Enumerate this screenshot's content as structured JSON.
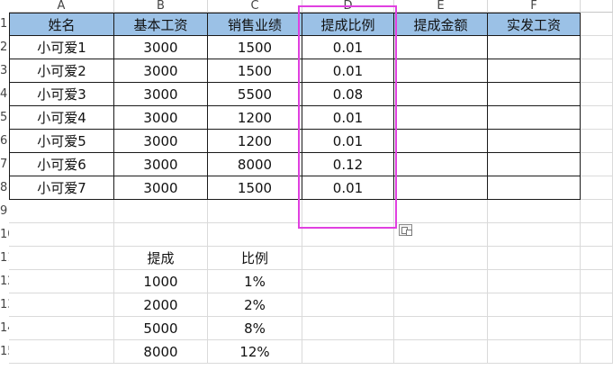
{
  "columns": [
    "A",
    "B",
    "C",
    "D",
    "E",
    "F"
  ],
  "rows": [
    "1",
    "2",
    "3",
    "4",
    "5",
    "6",
    "7",
    "8",
    "9",
    "10",
    "11",
    "12",
    "13",
    "14",
    "15"
  ],
  "table": {
    "headers": [
      "姓名",
      "基本工资",
      "销售业绩",
      "提成比例",
      "提成金额",
      "实发工资"
    ],
    "rows": [
      [
        "小可爱1",
        "3000",
        "1500",
        "0.01",
        "",
        ""
      ],
      [
        "小可爱2",
        "3000",
        "1500",
        "0.01",
        "",
        ""
      ],
      [
        "小可爱3",
        "3000",
        "5500",
        "0.08",
        "",
        ""
      ],
      [
        "小可爱4",
        "3000",
        "1200",
        "0.01",
        "",
        ""
      ],
      [
        "小可爱5",
        "3000",
        "1200",
        "0.01",
        "",
        ""
      ],
      [
        "小可爱6",
        "3000",
        "8000",
        "0.12",
        "",
        ""
      ],
      [
        "小可爱7",
        "3000",
        "1500",
        "0.01",
        "",
        ""
      ]
    ]
  },
  "lookup": {
    "headers": [
      "提成",
      "比例"
    ],
    "rows": [
      [
        "1000",
        "1%"
      ],
      [
        "2000",
        "2%"
      ],
      [
        "5000",
        "8%"
      ],
      [
        "8000",
        "12%"
      ]
    ]
  },
  "colors": {
    "header_fill": "#9bc1e6",
    "highlight_border": "#e040e0"
  },
  "icons": {
    "paste_options": "paste-options-icon"
  }
}
